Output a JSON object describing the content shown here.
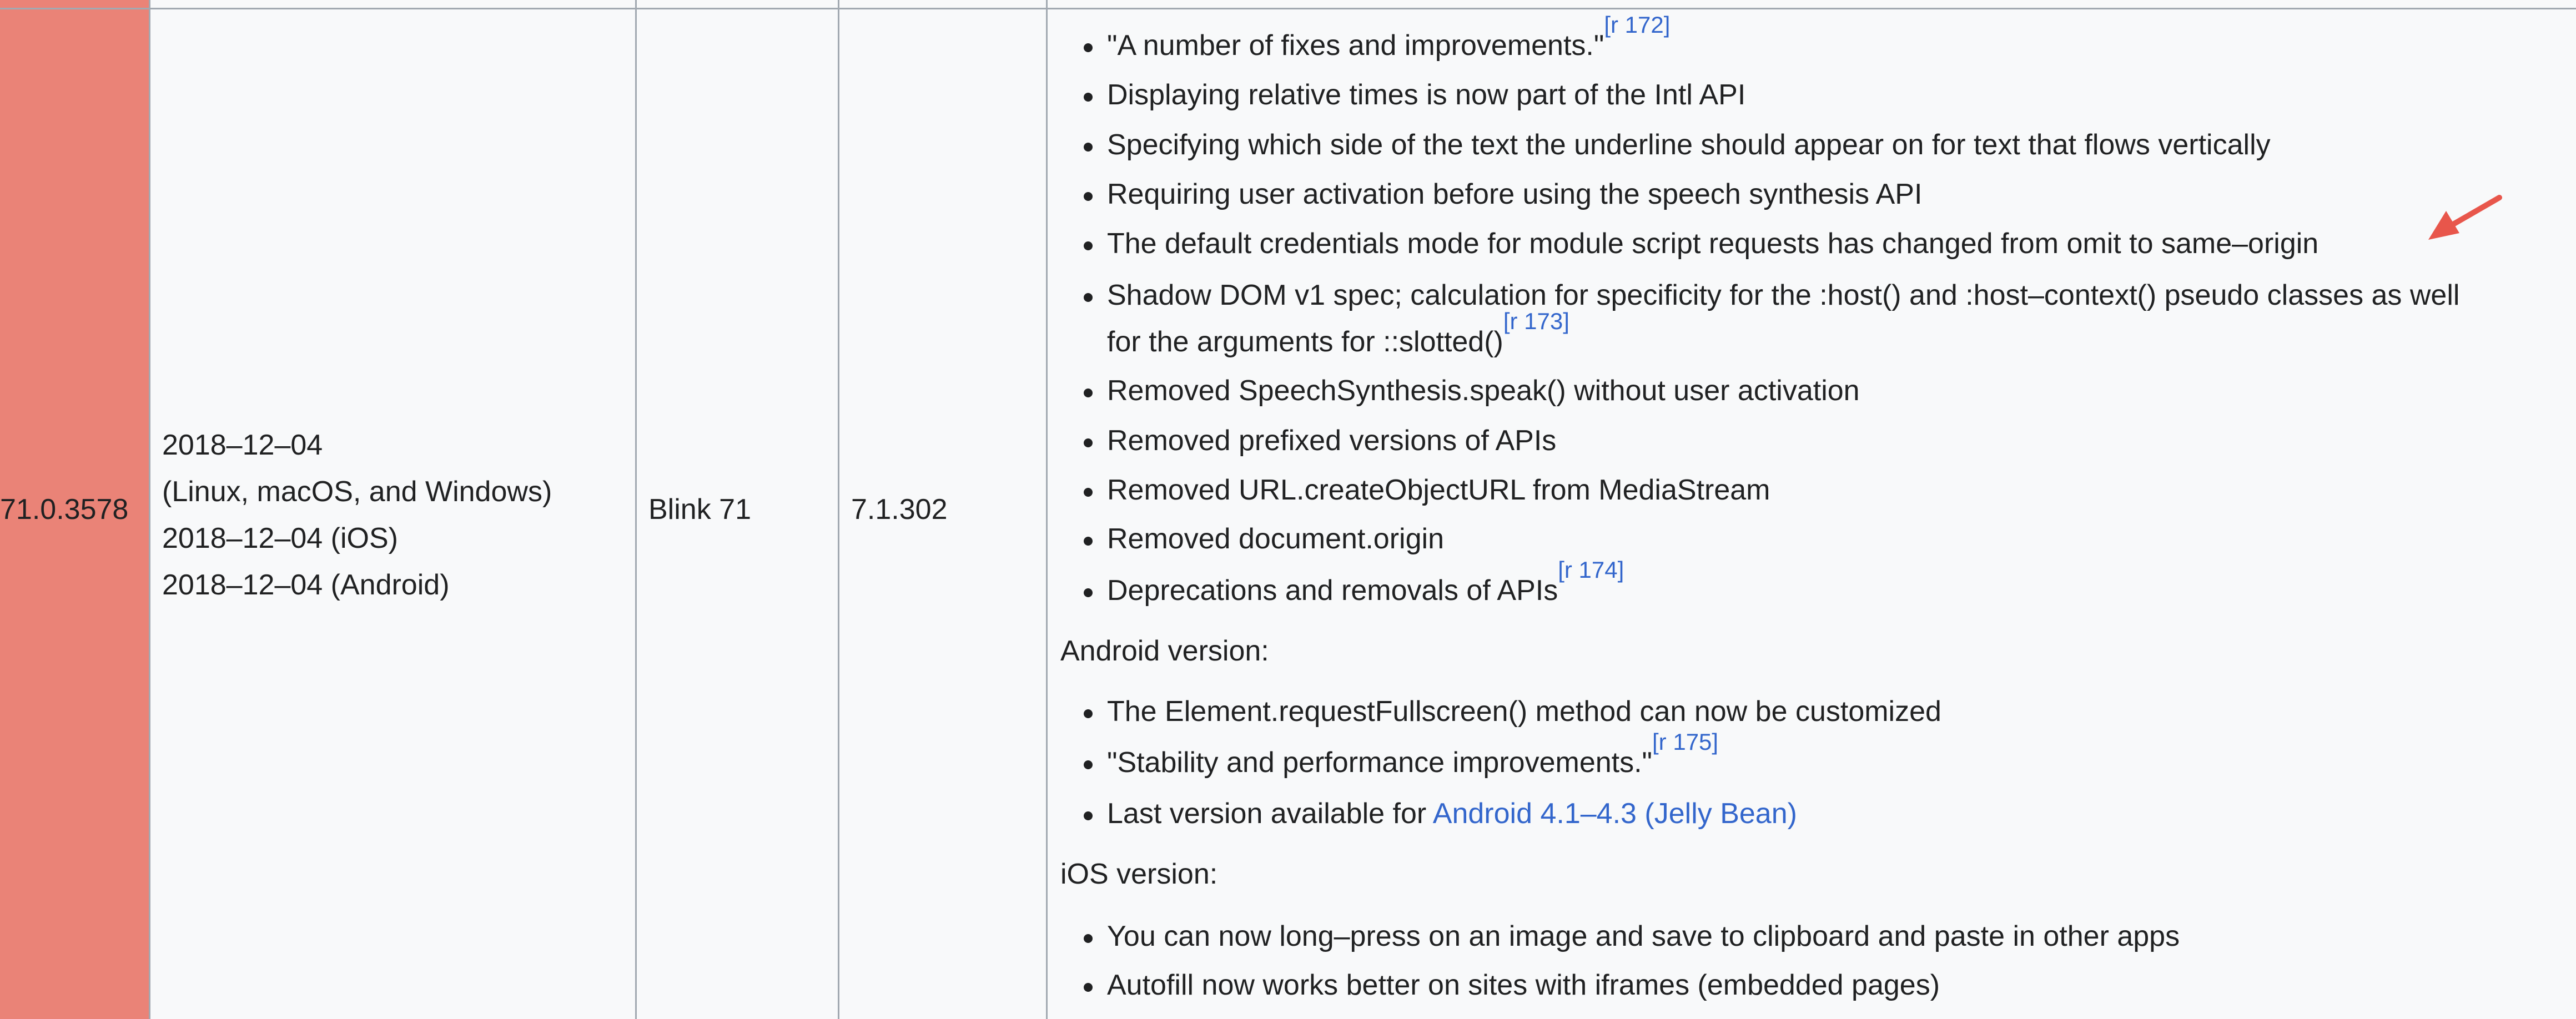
{
  "row": {
    "version": "71.0.3578",
    "release_dates": [
      "2018–12–04",
      "(Linux, macOS, and Windows)",
      "2018–12–04 (iOS)",
      "2018–12–04 (Android)"
    ],
    "engine": "Blink 71",
    "v8": "7.1.302"
  },
  "notes": {
    "desktop": [
      {
        "text": "\"A number of fixes and improvements.\"",
        "ref": "[r 172]"
      },
      {
        "text": "Displaying relative times is now part of the Intl API"
      },
      {
        "text": "Specifying which side of the text the underline should appear on for text that flows vertically"
      },
      {
        "text": "Requiring user activation before using the speech synthesis API"
      },
      {
        "text": "The default credentials mode for module script requests has changed from omit to same–origin"
      },
      {
        "text": "Shadow DOM v1 spec; calculation for specificity for the :host() and :host–context() pseudo classes as well"
      },
      {
        "text": "for the arguments for ::slotted()",
        "ref": "[r 173]"
      },
      {
        "text": "Removed SpeechSynthesis.speak() without user activation"
      },
      {
        "text": "Removed prefixed versions of APIs"
      },
      {
        "text": "Removed URL.createObjectURL from MediaStream"
      },
      {
        "text": "Removed document.origin"
      },
      {
        "text": "Deprecations and removals of APIs",
        "ref": "[r 174]"
      }
    ],
    "android_heading": "Android version:",
    "android": [
      {
        "text": "The Element.requestFullscreen() method can now be customized"
      },
      {
        "text": "\"Stability and performance improvements.\"",
        "ref": "[r 175]"
      },
      {
        "text": "Last version available for ",
        "link": "Android 4.1–4.3 (Jelly Bean)"
      }
    ],
    "ios_heading": "iOS version:",
    "ios": [
      {
        "text": "You can now long–press on an image and save to clipboard and paste in other apps"
      },
      {
        "text": "Autofill now works better on sites with iframes (embedded pages)"
      }
    ]
  },
  "colors": {
    "version_cell": "#ea8377",
    "background": "#f8f9fa",
    "border": "#a2a9b1",
    "link": "#3366cc",
    "annotation_arrow": "#e8564b"
  },
  "icons": {
    "annotation": "red-arrow-icon"
  }
}
